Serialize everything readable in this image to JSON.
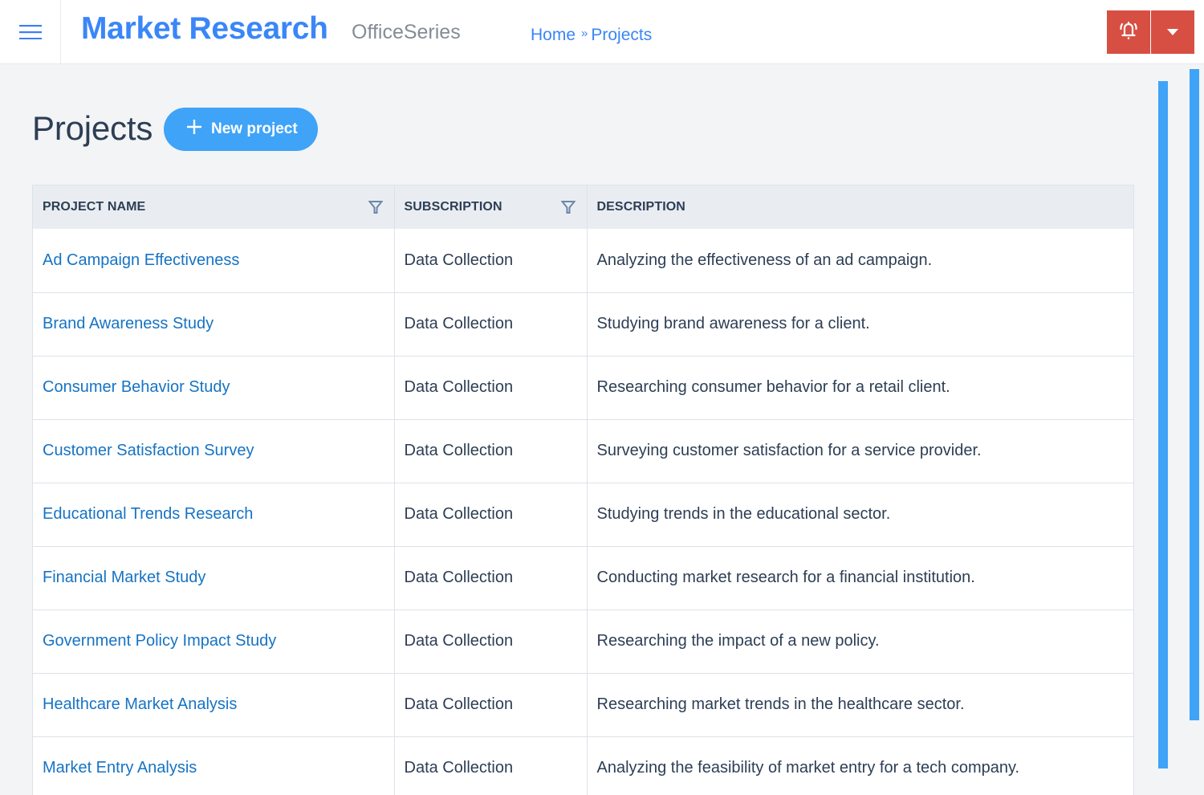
{
  "header": {
    "menu_icon": "hamburger-menu-icon",
    "app_title": "Market Research",
    "app_subtitle": "OfficeSeries",
    "breadcrumb": [
      {
        "label": "Home"
      },
      {
        "label": "Projects"
      }
    ],
    "breadcrumb_separator": "»",
    "actions": [
      {
        "icon": "bell-ringing-icon",
        "label": "Notifications"
      },
      {
        "icon": "caret-down-icon",
        "label": "Menu"
      }
    ],
    "action_color": "#d74f43"
  },
  "page": {
    "title": "Projects",
    "new_button_label": "New project",
    "new_button_icon": "plus-icon",
    "accent_color": "#3fa3f8"
  },
  "table": {
    "columns": [
      {
        "label": "PROJECT NAME",
        "filterable": true
      },
      {
        "label": "SUBSCRIPTION",
        "filterable": true
      },
      {
        "label": "DESCRIPTION",
        "filterable": false
      }
    ],
    "rows": [
      {
        "name": "Ad Campaign Effectiveness",
        "subscription": "Data Collection",
        "description": "Analyzing the effectiveness of an ad campaign."
      },
      {
        "name": "Brand Awareness Study",
        "subscription": "Data Collection",
        "description": "Studying brand awareness for a client."
      },
      {
        "name": "Consumer Behavior Study",
        "subscription": "Data Collection",
        "description": "Researching consumer behavior for a retail client."
      },
      {
        "name": "Customer Satisfaction Survey",
        "subscription": "Data Collection",
        "description": "Surveying customer satisfaction for a service provider."
      },
      {
        "name": "Educational Trends Research",
        "subscription": "Data Collection",
        "description": "Studying trends in the educational sector."
      },
      {
        "name": "Financial Market Study",
        "subscription": "Data Collection",
        "description": "Conducting market research for a financial institution."
      },
      {
        "name": "Government Policy Impact Study",
        "subscription": "Data Collection",
        "description": "Researching the impact of a new policy."
      },
      {
        "name": "Healthcare Market Analysis",
        "subscription": "Data Collection",
        "description": "Researching market trends in the healthcare sector."
      },
      {
        "name": "Market Entry Analysis",
        "subscription": "Data Collection",
        "description": "Analyzing the feasibility of market entry for a tech company."
      }
    ]
  }
}
